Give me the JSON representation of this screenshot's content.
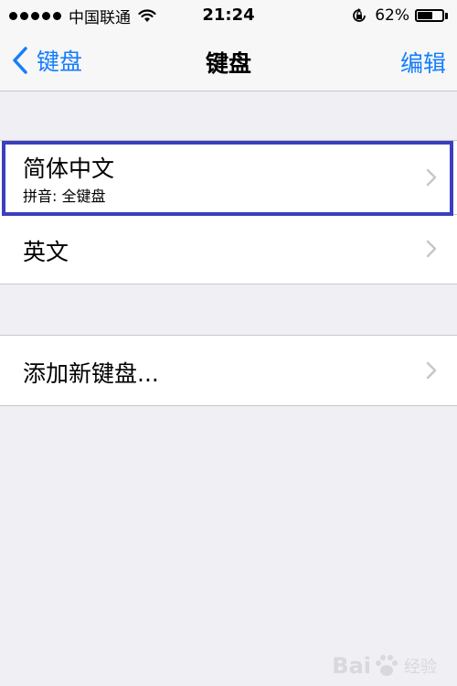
{
  "status_bar": {
    "carrier": "中国联通",
    "time": "21:24",
    "battery_percent": "62%",
    "battery_level": 0.62
  },
  "nav": {
    "back_label": "键盘",
    "title": "键盘",
    "edit_label": "编辑"
  },
  "keyboards": [
    {
      "title": "简体中文",
      "subtitle": "拼音: 全键盘"
    },
    {
      "title": "英文"
    }
  ],
  "add_keyboard": {
    "label": "添加新键盘..."
  },
  "watermark": {
    "brand": "Bai",
    "suffix": "经验"
  },
  "colors": {
    "accent": "#157efb",
    "highlight": "#3a3fbd",
    "background": "#efeff4"
  },
  "icons": [
    "signal-dots-icon",
    "wifi-icon",
    "rotation-lock-icon",
    "battery-icon",
    "back-chevron-icon",
    "chevron-right-icon",
    "paw-icon"
  ]
}
